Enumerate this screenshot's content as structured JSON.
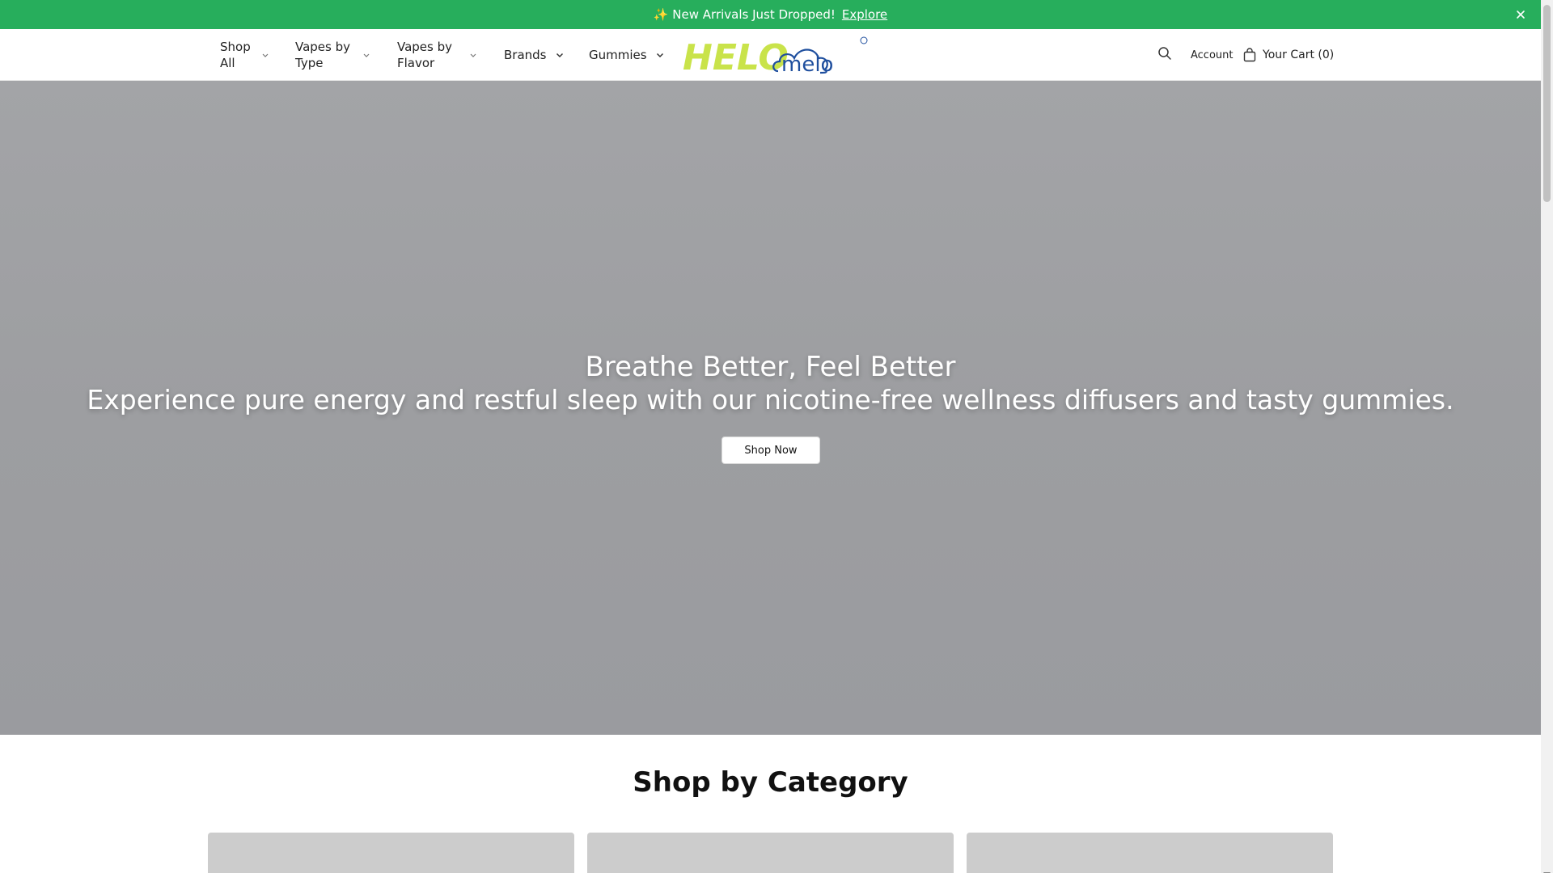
{
  "announcement": {
    "sparkle": "✨",
    "text": "New Arrivals Just Dropped!",
    "link_label": "Explore",
    "close_glyph": "×"
  },
  "nav": {
    "items": [
      {
        "line1": "Shop",
        "line2": "All"
      },
      {
        "line1": "Vapes by",
        "line2": "Type"
      },
      {
        "line1": "Vapes by",
        "line2": "Flavor"
      },
      {
        "line1": "Brands",
        "line2": ""
      },
      {
        "line1": "Gummies",
        "line2": ""
      }
    ]
  },
  "logos": {
    "helo_text": "HELO",
    "melo_text": "melo"
  },
  "header_right": {
    "account_label": "Account",
    "cart_label": "Your Cart (0)"
  },
  "hero": {
    "title": "Breathe Better, Feel Better",
    "subtitle": "Experience pure energy and restful sleep with our nicotine-free wellness diffusers and tasty gummies.",
    "cta_label": "Shop Now"
  },
  "category": {
    "title": "Shop by Category"
  },
  "colors": {
    "announcement_bg": "#27ae5c",
    "hero_bg": "#9e9fa2",
    "helo_green": "#c9e34a",
    "melo_blue": "#1f4f9e"
  },
  "icons": [
    "close-icon",
    "chevron-down-icon",
    "search-icon",
    "bag-icon"
  ]
}
